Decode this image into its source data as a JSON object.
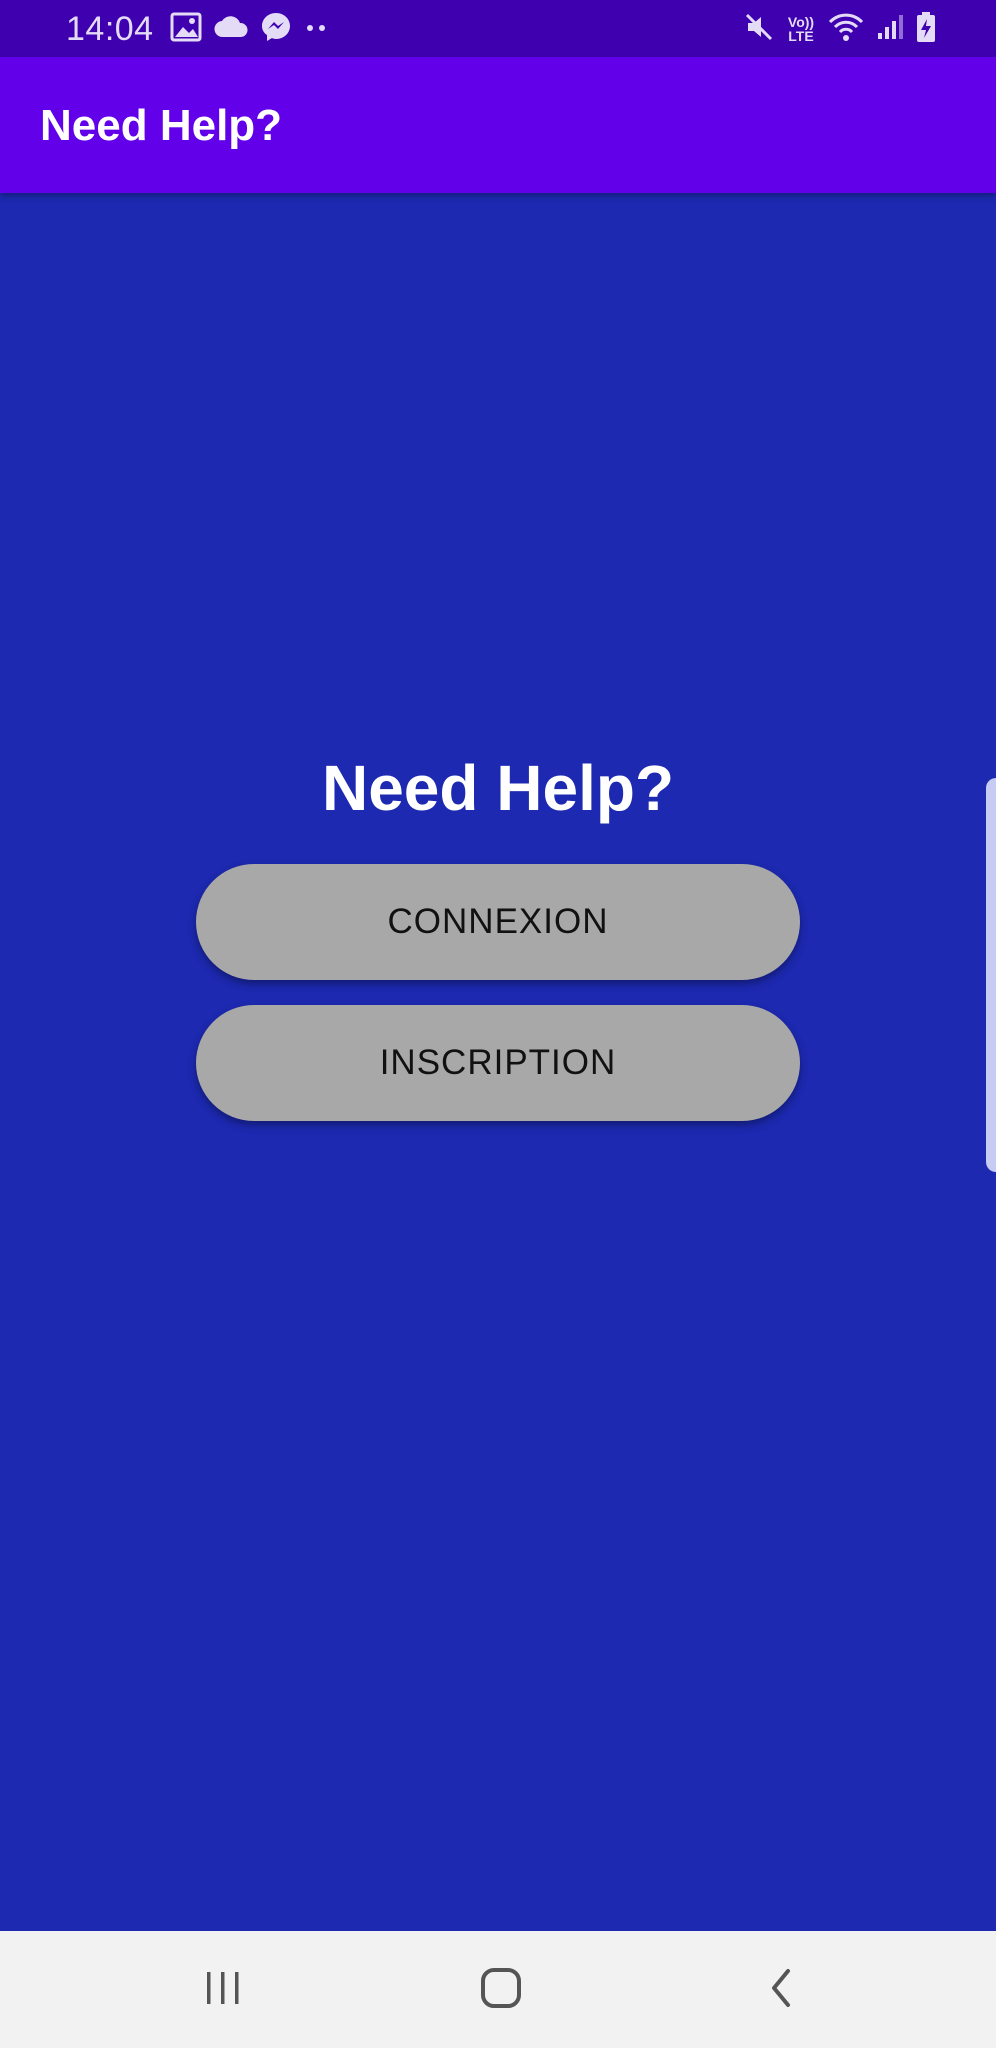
{
  "status_bar": {
    "time": "14:04",
    "lte_top": "Vo))",
    "lte_bottom": "LTE",
    "left_icons": [
      "image-icon",
      "cloud-icon",
      "messenger-icon",
      "more-dots-icon"
    ],
    "right_icons": [
      "mute-icon",
      "volte-icon",
      "wifi-icon",
      "signal-icon",
      "battery-charging-icon"
    ]
  },
  "app_bar": {
    "title": "Need Help?"
  },
  "main": {
    "heading": "Need Help?",
    "connexion_label": "CONNEXION",
    "inscription_label": "INSCRIPTION"
  },
  "nav_bar": {
    "icons": [
      "recents-icon",
      "home-icon",
      "back-icon"
    ]
  },
  "colors": {
    "status_bar": "#3f00b0",
    "app_bar": "#6200ea",
    "background": "#1c29b0",
    "button": "#a8a8a8",
    "nav_bar": "#f2f2f2"
  }
}
